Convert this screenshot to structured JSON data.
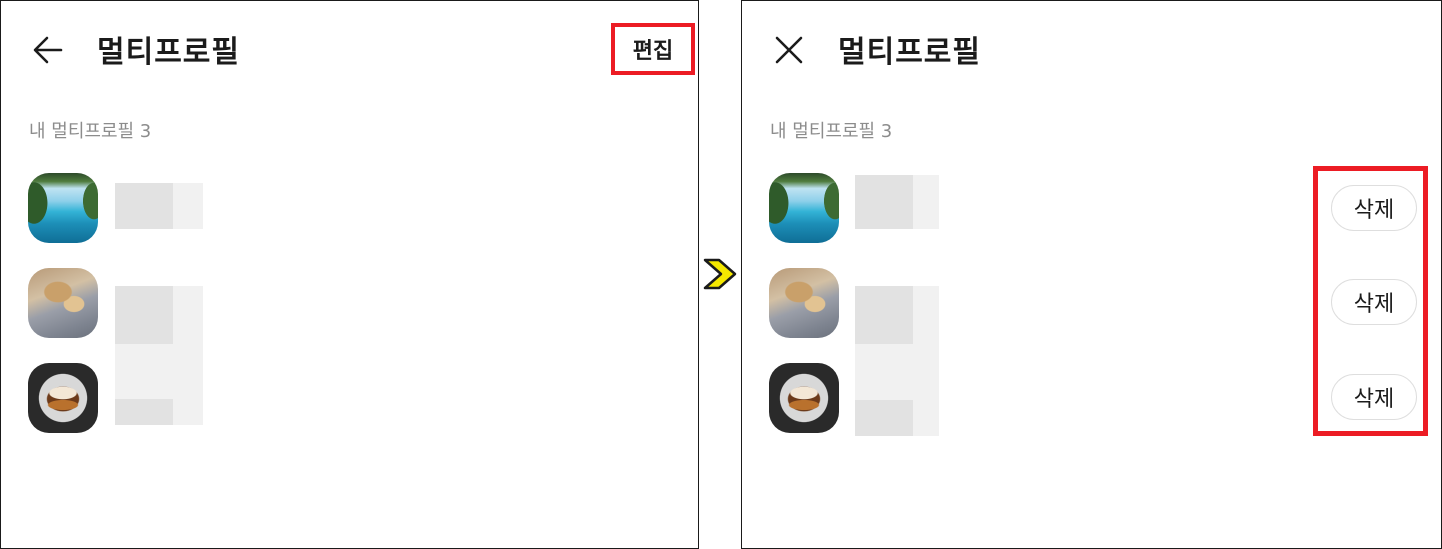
{
  "left_screen": {
    "title": "멀티프로필",
    "back_icon": "arrow-left-icon",
    "edit_label": "편집",
    "section_label": "내 멀티프로필 3",
    "profiles": [
      {
        "avatar": "beach-photo"
      },
      {
        "avatar": "dog-photo"
      },
      {
        "avatar": "food-photo"
      }
    ]
  },
  "right_screen": {
    "title": "멀티프로필",
    "close_icon": "close-x-icon",
    "section_label": "내 멀티프로필 3",
    "delete_label": "삭제",
    "profiles": [
      {
        "avatar": "beach-photo"
      },
      {
        "avatar": "dog-photo"
      },
      {
        "avatar": "food-photo"
      }
    ]
  },
  "colors": {
    "highlight": "#ec1c24",
    "arrow_fill": "#f5e800",
    "title_text": "#1b1b1b",
    "muted_text": "#8c8c8c"
  },
  "transition_icon": "chevron-right-icon"
}
